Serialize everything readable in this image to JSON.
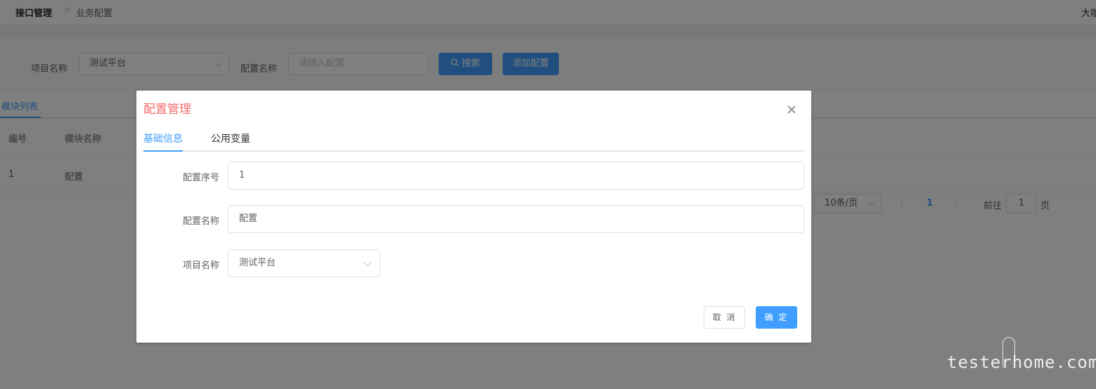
{
  "breadcrumb": {
    "parent": "接口管理",
    "separator": ">",
    "current": "业务配置"
  },
  "header": {
    "user": "大咖"
  },
  "filter": {
    "project_label": "项目名称",
    "project_value": "测试平台",
    "config_label": "配置名称",
    "config_placeholder": "请输入配置",
    "search_label": "搜索",
    "add_label": "添加配置"
  },
  "tabs": {
    "module_list": "模块列表"
  },
  "table": {
    "headers": [
      "编号",
      "模块名称"
    ],
    "rows": [
      [
        "1",
        "配置"
      ]
    ]
  },
  "pagination": {
    "page_size": "10条/页",
    "current_page": "1",
    "goto_label": "前往",
    "goto_value": "1",
    "page_suffix": "页"
  },
  "dialog": {
    "title": "配置管理",
    "tabs": [
      "基础信息",
      "公用变量"
    ],
    "fields": [
      {
        "label": "配置序号",
        "value": "1"
      },
      {
        "label": "配置名称",
        "value": "配置"
      },
      {
        "label": "项目名称",
        "value": "测试平台"
      }
    ],
    "cancel_label": "取 消",
    "ok_label": "确 定"
  },
  "watermark": "testerhome.com",
  "colors": {
    "primary": "#409eff",
    "title": "#f56c6c",
    "overlay": "rgba(0,0,0,0.5)"
  }
}
